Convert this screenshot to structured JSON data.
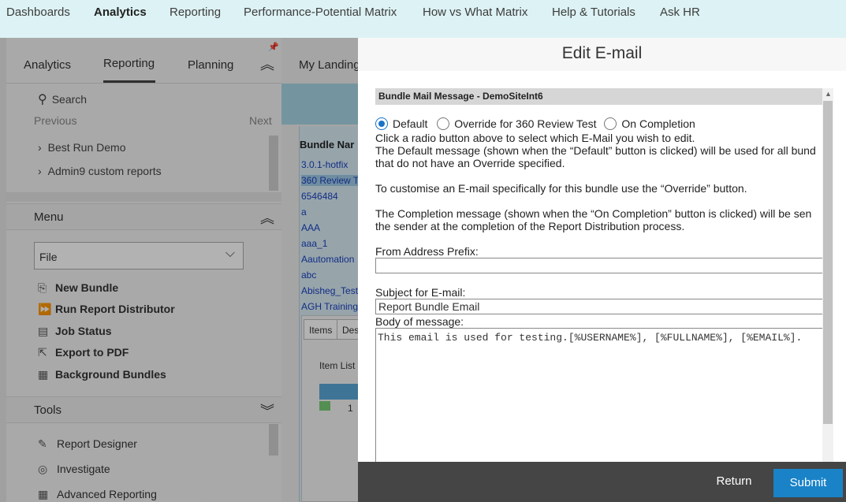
{
  "top_nav": {
    "items": [
      "Dashboards",
      "Analytics",
      "Reporting",
      "Performance-Potential Matrix",
      "How vs What Matrix",
      "Help & Tutorials",
      "Ask HR"
    ],
    "active": "Analytics"
  },
  "left_panel": {
    "tabs": [
      "Analytics",
      "Reporting",
      "Planning"
    ],
    "active_tab": "Reporting",
    "search_label": "Search",
    "previous_label": "Previous",
    "next_label": "Next",
    "recent": [
      "Best Run Demo",
      "Admin9 custom reports"
    ],
    "menu_title": "Menu",
    "file_select": "File",
    "menu_items": [
      "New Bundle",
      "Run Report Distributor",
      "Job Status",
      "Export to PDF",
      "Background Bundles"
    ],
    "tools_title": "Tools",
    "tool_items": [
      "Report Designer",
      "Investigate",
      "Advanced Reporting"
    ]
  },
  "background": {
    "landing_label": "My Landing",
    "bundle_header": "Bundle Nar",
    "bundle_rows": [
      "3.0.1-hotfix",
      "360 Review T",
      "6546484",
      "a",
      "AAA",
      "aaa_1",
      "Aautomation",
      "abc",
      "Abisheg_Test",
      "AGH Training"
    ],
    "selected_row": "360 Review T",
    "tabs": [
      "Items",
      "Des"
    ],
    "item_list_label": "Item List",
    "item_count": "1"
  },
  "modal": {
    "title": "Edit E-mail",
    "bundle_bar": "Bundle Mail Message - DemoSiteInt6",
    "radio_options": [
      "Default",
      "Override for 360 Review Test",
      "On Completion"
    ],
    "radio_selected": "Default",
    "instructions": [
      "Click a radio button above to select which E-Mail you wish to edit.",
      "The Default message (shown when the “Default” button is clicked) will be used for all bund",
      "that do not have an Override specified.",
      "To customise an E-mail specifically for this bundle use the “Override” button.",
      "The Completion message (shown when the “On Completion” button is clicked) will be sen",
      "the sender at the completion of the Report Distribution process."
    ],
    "from_label": "From Address Prefix:",
    "from_value": "",
    "subject_label": "Subject for E-mail:",
    "subject_value": "Report Bundle Email",
    "body_label": "Body of message:",
    "body_value": "This email is used for testing.[%USERNAME%], [%FULLNAME%], [%EMAIL%].",
    "return_label": "Return",
    "submit_label": "Submit",
    "colors": {
      "submit": "#1a83c8",
      "footer": "#454545",
      "radio_selected": "#1a73c8"
    }
  }
}
